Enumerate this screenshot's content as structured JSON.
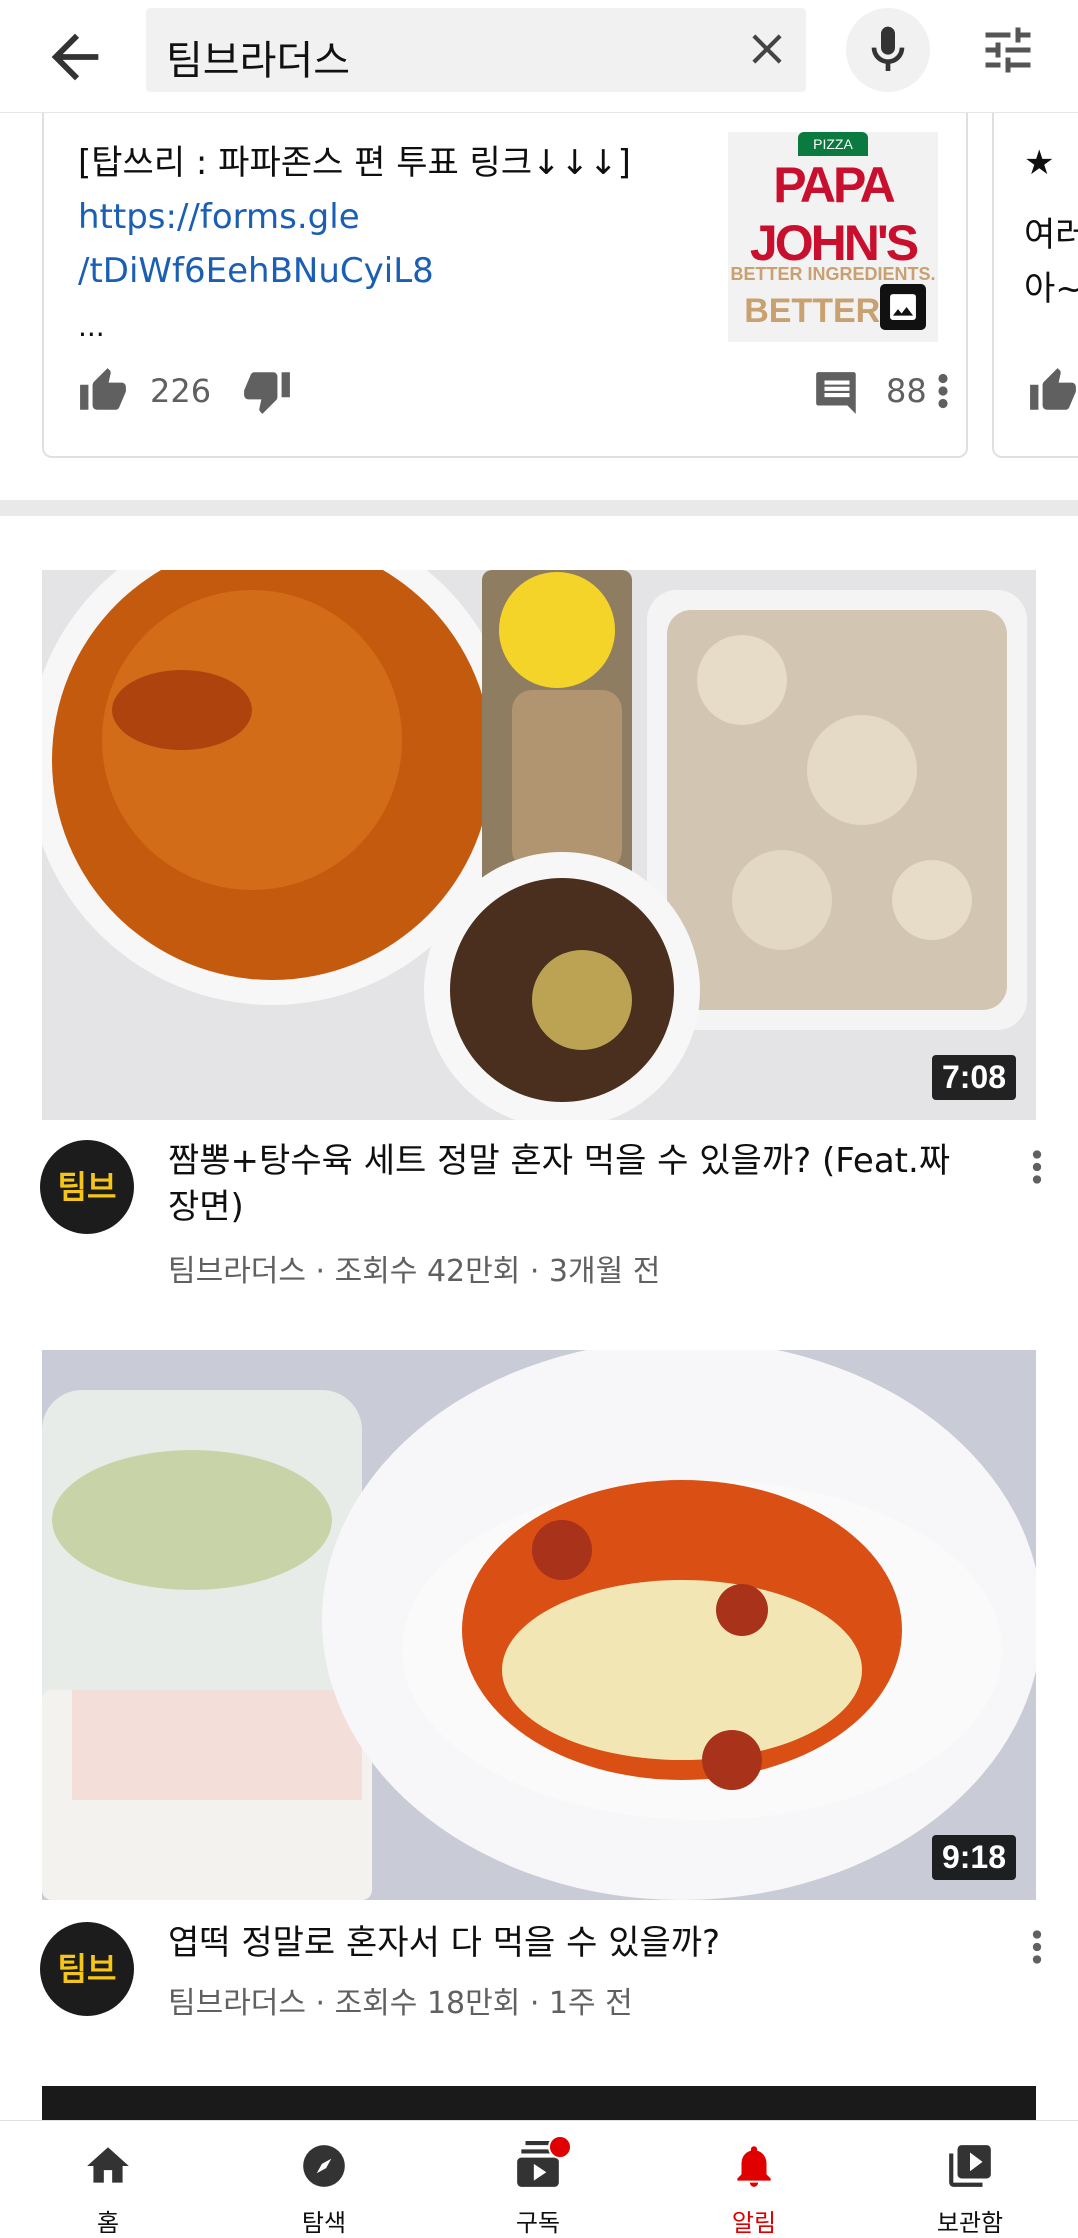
{
  "search": {
    "query": "팀브라더스"
  },
  "post": {
    "text": "[탑쓰리 : 파파존스 편 투표 링크↓↓↓]",
    "link_line1": "https://forms.gle",
    "link_line2": "/tDiWf6EehBNuCyiL8",
    "ellipsis": "...",
    "likes": "226",
    "comments": "88",
    "thumb": {
      "pizza": "PIZZA",
      "brand": "PAPA JOHN'S",
      "tagline1": "BETTER INGREDIENTS.",
      "tagline2": "BETTER PI"
    }
  },
  "post2": {
    "line1": "★",
    "line2": "여러",
    "line3": "아~"
  },
  "videos": [
    {
      "title": "짬뽕+탕수육 세트 정말 혼자 먹을 수 있을까? (Feat.짜장면)",
      "channel_meta": "팀브라더스 · 조회수 42만회 · 3개월 전",
      "duration": "7:08",
      "avatar_text": "팀브"
    },
    {
      "title": "엽떡 정말로 혼자서 다 먹을 수 있을까?",
      "channel_meta": "팀브라더스 · 조회수 18만회 · 1주 전",
      "duration": "9:18",
      "avatar_text": "팀브"
    }
  ],
  "nav": [
    {
      "label": "홈",
      "icon": "home-icon"
    },
    {
      "label": "탐색",
      "icon": "explore-icon"
    },
    {
      "label": "구독",
      "icon": "subscriptions-icon"
    },
    {
      "label": "알림",
      "icon": "bell-icon",
      "active": true
    },
    {
      "label": "보관함",
      "icon": "library-icon"
    }
  ],
  "colors": {
    "accent": "#e00000",
    "link": "#1a5fb4",
    "meta": "#606060"
  }
}
